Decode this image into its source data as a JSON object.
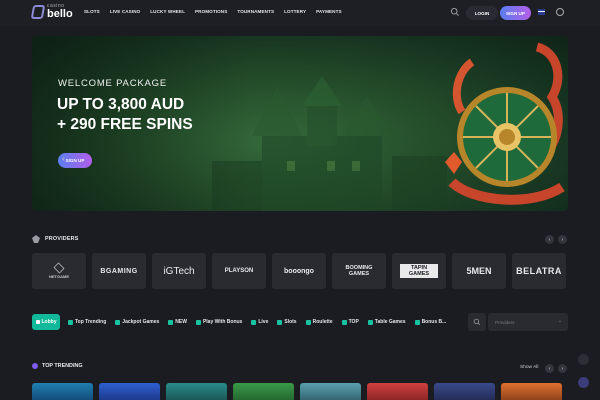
{
  "logo": {
    "small": "casino",
    "big": "bello"
  },
  "nav": [
    "SLOTS",
    "LIVE CASINO",
    "LUCKY WHEEL",
    "PROMOTIONS",
    "TOURNAMENTS",
    "LOTTERY",
    "PAYMENTS"
  ],
  "header": {
    "login": "LOGIN",
    "signup": "SIGN UP"
  },
  "banner": {
    "label": "WELCOME PACKAGE",
    "line1": "UP TO 3,800 AUD",
    "line2": "+ 290 FREE SPINS",
    "button": "SIGN UP"
  },
  "providers": {
    "title": "PROVIDERS",
    "items": [
      "NETGAME",
      "BGAMING",
      "iGTech",
      "PLAYSON",
      "booongo",
      "BOOMING GAMES",
      "TAPIN GAMES",
      "5MEN",
      "BELATRA"
    ]
  },
  "categories": {
    "lobby": "Lobby",
    "items": [
      "Top Trending",
      "Jackpot Games",
      "NEW",
      "Play With Bonus",
      "Live",
      "Slots",
      "Roulette",
      "TOP",
      "Table Games",
      "Bonus B..."
    ],
    "provider_placeholder": "Providers"
  },
  "trending": {
    "title": "TOP TRENDING",
    "show_all": "Show All"
  },
  "colors": {
    "accent": "#12b89a",
    "gradient_start": "#5a7ef0",
    "gradient_end": "#b35ee8",
    "bg": "#1b1c21"
  }
}
